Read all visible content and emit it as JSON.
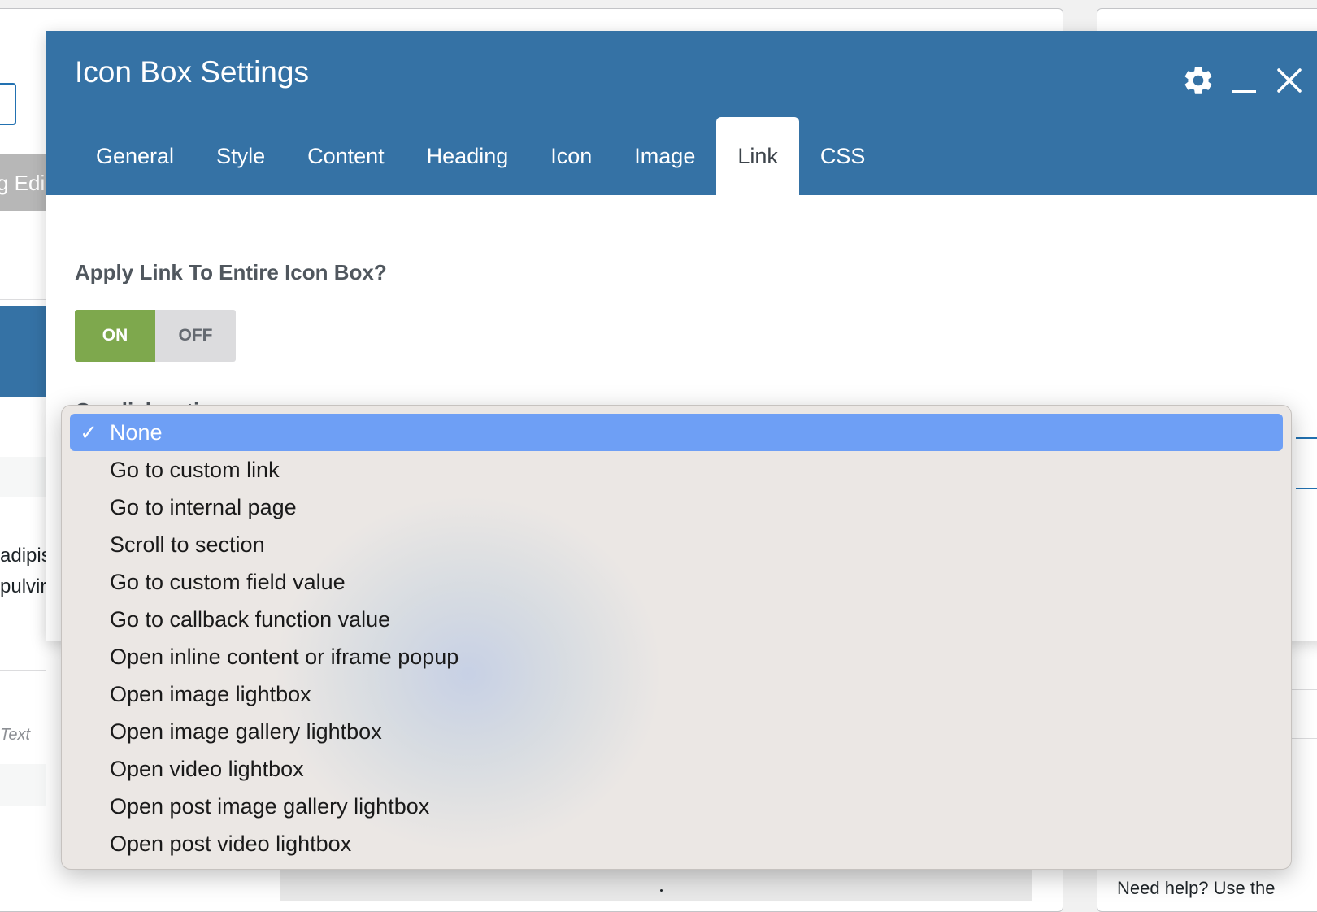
{
  "background": {
    "partial_tab_label": "g Edi",
    "partial_text_1": "adipis",
    "partial_text_2": "pulvir",
    "partial_placeholder": "Text",
    "help_text": "Need help? Use the"
  },
  "modal": {
    "title": "Icon Box Settings",
    "icons": {
      "settings": "gear-icon",
      "minimize": "minimize-icon",
      "close": "close-icon"
    },
    "tabs": [
      {
        "label": "General",
        "active": false
      },
      {
        "label": "Style",
        "active": false
      },
      {
        "label": "Content",
        "active": false
      },
      {
        "label": "Heading",
        "active": false
      },
      {
        "label": "Icon",
        "active": false
      },
      {
        "label": "Image",
        "active": false
      },
      {
        "label": "Link",
        "active": true
      },
      {
        "label": "CSS",
        "active": false
      }
    ],
    "apply_link": {
      "label": "Apply Link To Entire Icon Box?",
      "on_label": "ON",
      "off_label": "OFF",
      "value": "ON"
    },
    "on_click": {
      "label": "On click action",
      "selected": "None"
    }
  },
  "dropdown": {
    "check_mark": "✓",
    "options": [
      "None",
      "Go to custom link",
      "Go to internal page",
      "Scroll to section",
      "Go to custom field value",
      "Go to callback function value",
      "Open inline content or iframe popup",
      "Open image lightbox",
      "Open image gallery lightbox",
      "Open video lightbox",
      "Open post image gallery lightbox",
      "Open post video lightbox"
    ]
  },
  "colors": {
    "header_blue": "#3572a5",
    "toggle_on": "#7ea84d",
    "selected_option": "#6e9ff5",
    "dropdown_bg": "#ebe7e4"
  }
}
